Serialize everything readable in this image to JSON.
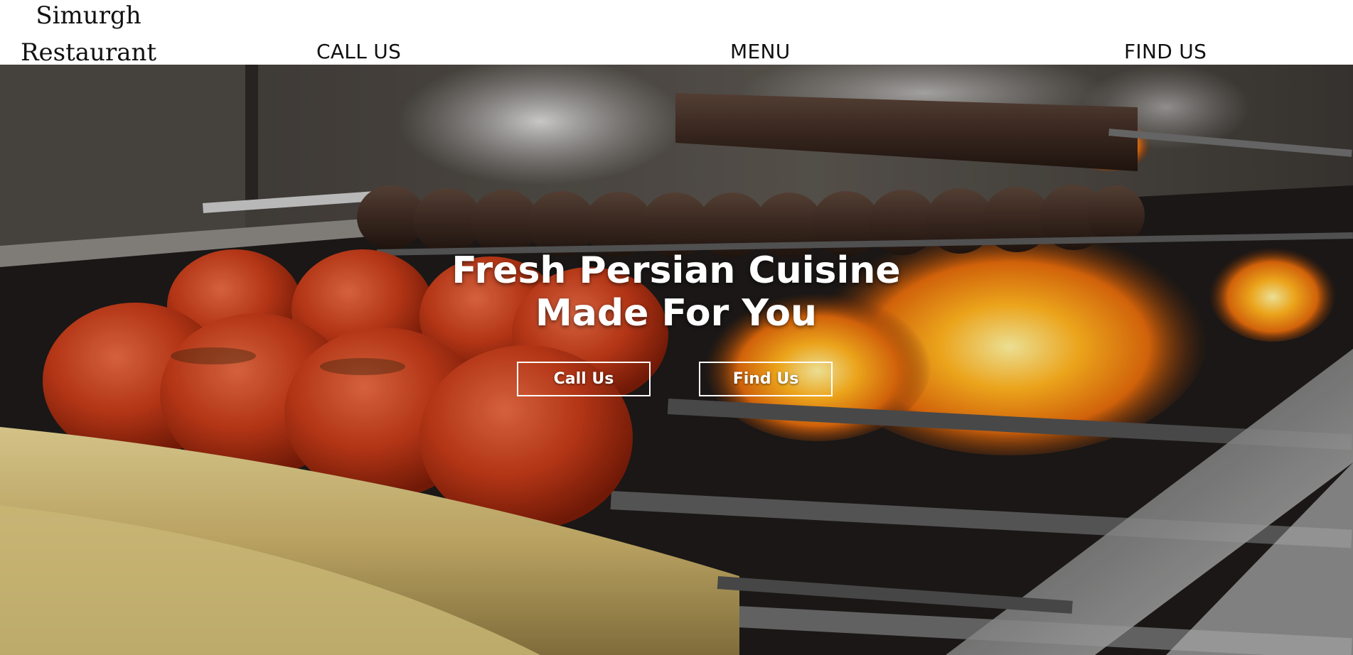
{
  "header": {
    "logo_line1": "Simurgh",
    "logo_line2": "Restaurant",
    "nav": {
      "call_us": "CALL US",
      "menu": "MENU",
      "find_us": "FIND US"
    }
  },
  "hero": {
    "title_line1": "Fresh Persian Cuisine",
    "title_line2": "Made For You",
    "buttons": {
      "call_us": "Call Us",
      "find_us": "Find Us"
    }
  },
  "colors": {
    "header_bg": "#ffffff",
    "nav_text": "#111111",
    "hero_text": "#ffffff",
    "button_border": "#ffffff"
  }
}
